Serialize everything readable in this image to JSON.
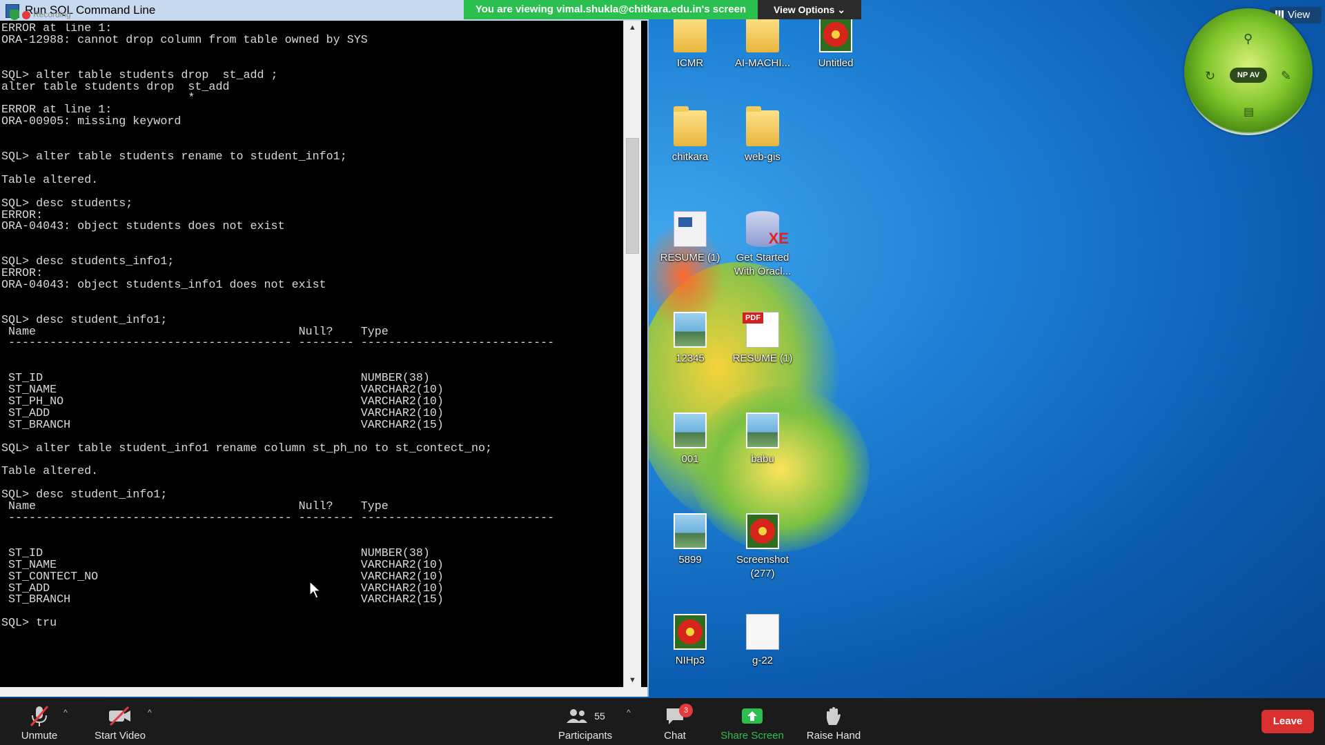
{
  "window": {
    "title": "Run SQL Command Line",
    "recording_label": "Recording"
  },
  "console_lines": [
    "ERROR at line 1:",
    "ORA-12988: cannot drop column from table owned by SYS",
    "",
    "",
    "SQL> alter table students drop  st_add ;",
    "alter table students drop  st_add",
    "                           *",
    "ERROR at line 1:",
    "ORA-00905: missing keyword",
    "",
    "",
    "SQL> alter table students rename to student_info1;",
    "",
    "Table altered.",
    "",
    "SQL> desc students;",
    "ERROR:",
    "ORA-04043: object students does not exist",
    "",
    "",
    "SQL> desc students_info1;",
    "ERROR:",
    "ORA-04043: object students_info1 does not exist",
    "",
    "",
    "SQL> desc student_info1;",
    " Name                                      Null?    Type",
    " ----------------------------------------- -------- ----------------------------",
    "",
    "",
    " ST_ID                                              NUMBER(38)",
    " ST_NAME                                            VARCHAR2(10)",
    " ST_PH_NO                                           VARCHAR2(10)",
    " ST_ADD                                             VARCHAR2(10)",
    " ST_BRANCH                                          VARCHAR2(15)",
    "",
    "SQL> alter table student_info1 rename column st_ph_no to st_contect_no;",
    "",
    "Table altered.",
    "",
    "SQL> desc student_info1;",
    " Name                                      Null?    Type",
    " ----------------------------------------- -------- ----------------------------",
    "",
    "",
    " ST_ID                                              NUMBER(38)",
    " ST_NAME                                            VARCHAR2(10)",
    " ST_CONTECT_NO                                      VARCHAR2(10)",
    " ST_ADD                                             VARCHAR2(10)",
    " ST_BRANCH                                          VARCHAR2(15)",
    "",
    "SQL> tru"
  ],
  "share_banner": {
    "text": "You are viewing vimal.shukla@chitkara.edu.in's screen",
    "view_options": "View Options",
    "view": "View"
  },
  "gadget": {
    "label": "NP AV"
  },
  "desktop_icons": [
    {
      "label": "ICMR",
      "kind": "folder"
    },
    {
      "label": "AI-MACHI...",
      "kind": "folder"
    },
    {
      "label": "Untitled",
      "kind": "flower"
    },
    {
      "label": "chitkara",
      "kind": "folder"
    },
    {
      "label": "web-gis",
      "kind": "folder"
    },
    {
      "label": "RESUME (1)",
      "kind": "word"
    },
    {
      "label": "Get Started With Oracl...",
      "kind": "db",
      "badge": "XE"
    },
    {
      "label": "12345",
      "kind": "image"
    },
    {
      "label": "RESUME (1)",
      "kind": "pdf",
      "badge": "PDF"
    },
    {
      "label": "001",
      "kind": "image"
    },
    {
      "label": "babu",
      "kind": "image"
    },
    {
      "label": "5899",
      "kind": "image"
    },
    {
      "label": "Screenshot (277)",
      "kind": "flower"
    },
    {
      "label": "NIHp3",
      "kind": "flower"
    },
    {
      "label": "g-22",
      "kind": "blank"
    }
  ],
  "toolbar": {
    "unmute": "Unmute",
    "start_video": "Start Video",
    "participants": "Participants",
    "participant_count": "55",
    "chat": "Chat",
    "chat_badge": "3",
    "share_screen": "Share Screen",
    "raise_hand": "Raise Hand",
    "leave": "Leave"
  }
}
